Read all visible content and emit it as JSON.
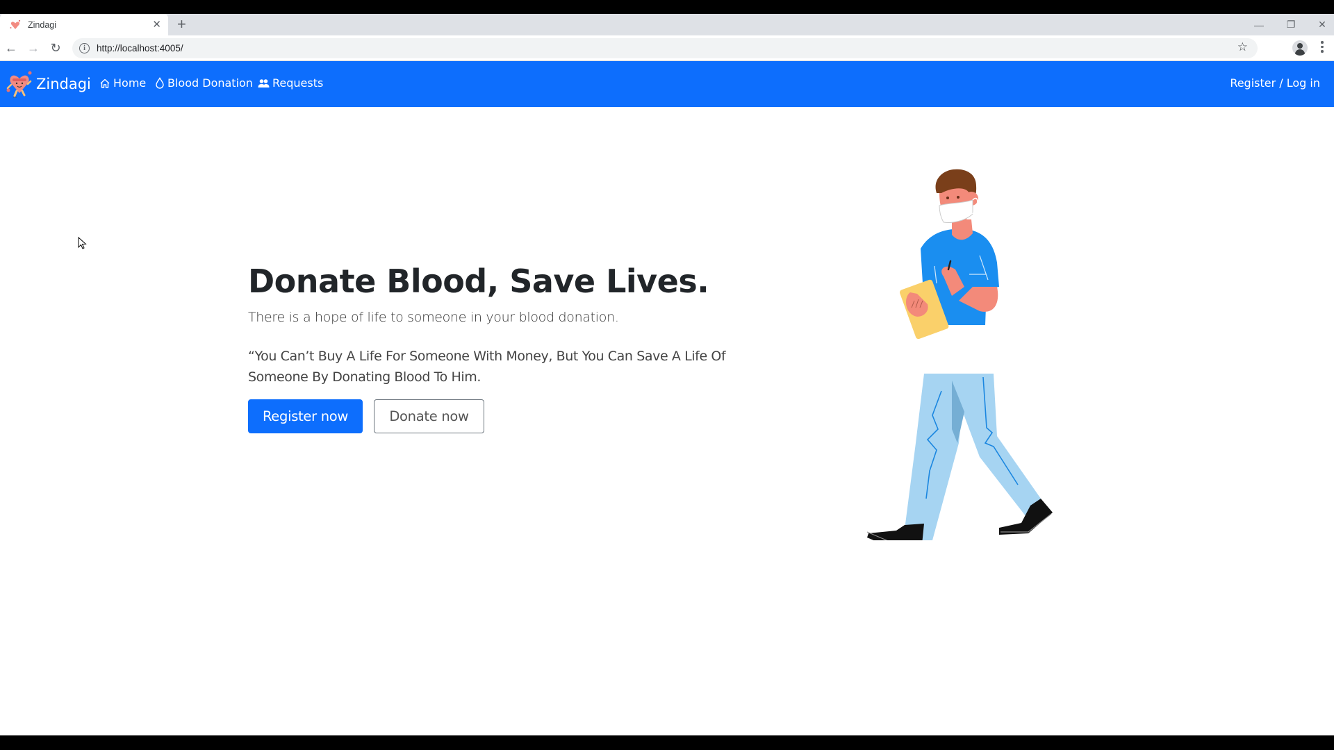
{
  "browser": {
    "tab_title": "Zindagi",
    "tab_close_icon": "close-icon",
    "new_tab_icon": "plus-icon",
    "url": "http://localhost:4005/",
    "window_controls": [
      "minimize",
      "restore",
      "close"
    ]
  },
  "navbar": {
    "brand": "Zindagi",
    "links": [
      {
        "label": "Home",
        "icon": "house-icon"
      },
      {
        "label": "Blood Donation",
        "icon": "droplet-icon"
      },
      {
        "label": "Requests",
        "icon": "people-icon"
      }
    ],
    "auth_link": "Register / Log in",
    "color": "#0d6efd"
  },
  "hero": {
    "title": "Donate Blood, Save Lives.",
    "lead": "There is a hope of life to someone in your blood donation.",
    "quote": "“You Can’t Buy A Life For Someone With Money, But You Can Save A Life Of Someone By Donating Blood To Him.",
    "primary_button": "Register now",
    "secondary_button": "Donate now"
  },
  "illustration": {
    "subject": "masked health worker walking with clipboard"
  }
}
